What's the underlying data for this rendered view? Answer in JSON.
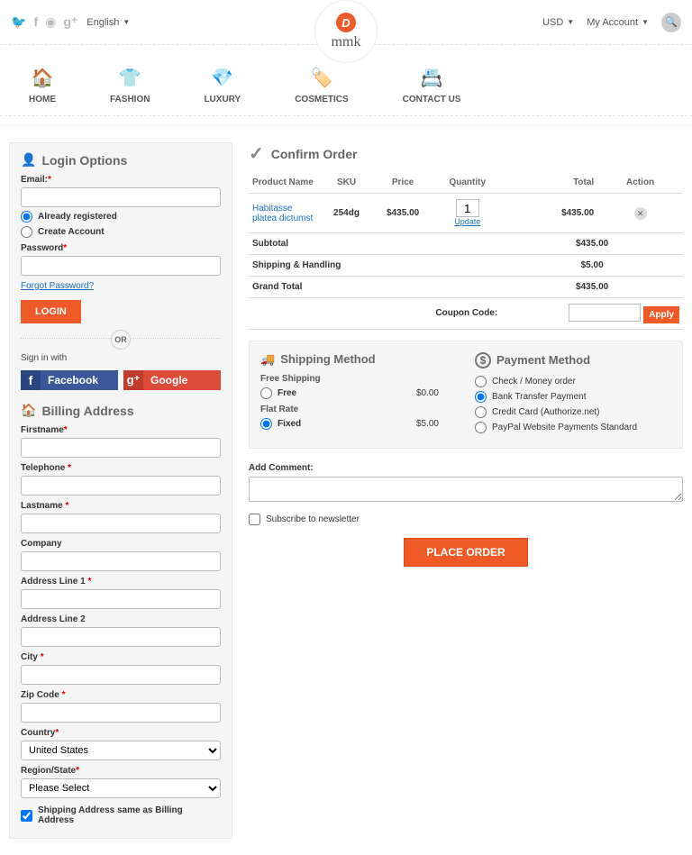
{
  "topbar": {
    "language": "English",
    "currency": "USD",
    "account": "My Account"
  },
  "logo": {
    "letter": "D",
    "name": "mmk"
  },
  "nav": [
    "HOME",
    "FASHION",
    "LUXURY",
    "COSMETICS",
    "CONTACT US"
  ],
  "login": {
    "title": "Login Options",
    "email_label": "Email:",
    "already": "Already registered",
    "create": "Create Account",
    "password_label": "Password",
    "forgot": "Forgot Password?",
    "login_btn": "LOGIN",
    "or": "OR",
    "signin_with": "Sign in with",
    "facebook": "Facebook",
    "google": "Google"
  },
  "billing": {
    "title": "Billing Address",
    "firstname": "Firstname",
    "telephone": "Telephone",
    "lastname": "Lastname",
    "company": "Company",
    "addr1": "Address Line 1",
    "addr2": "Address Line 2",
    "city": "City",
    "zip": "Zip Code",
    "country": "Country",
    "country_val": "United States",
    "region": "Region/State",
    "region_val": "Please Select",
    "same": "Shipping Address same as Billing Address"
  },
  "order": {
    "title": "Confirm Order",
    "headers": {
      "product": "Product Name",
      "sku": "SKU",
      "price": "Price",
      "qty": "Quantity",
      "total": "Total",
      "action": "Action"
    },
    "item": {
      "name": "Habitasse platea dictumst",
      "sku": "254dg",
      "price": "$435.00",
      "qty": "1",
      "update": "Update",
      "total": "$435.00"
    },
    "subtotal_lbl": "Subtotal",
    "subtotal": "$435.00",
    "shipping_lbl": "Shipping & Handling",
    "shipping": "$5.00",
    "grand_lbl": "Grand Total",
    "grand": "$435.00",
    "coupon_lbl": "Coupon Code:",
    "apply": "Apply"
  },
  "shipping": {
    "title": "Shipping Method",
    "free_label": "Free Shipping",
    "free_opt": "Free",
    "free_price": "$0.00",
    "flat_label": "Flat Rate",
    "flat_opt": "Fixed",
    "flat_price": "$5.00"
  },
  "payment": {
    "title": "Payment Method",
    "opts": [
      "Check / Money order",
      "Bank Transfer Payment",
      "Credit Card (Authorize.net)",
      "PayPal Website Payments Standard"
    ]
  },
  "comment_label": "Add Comment:",
  "subscribe": "Subscribe to newsletter",
  "place_order": "PLACE ORDER"
}
